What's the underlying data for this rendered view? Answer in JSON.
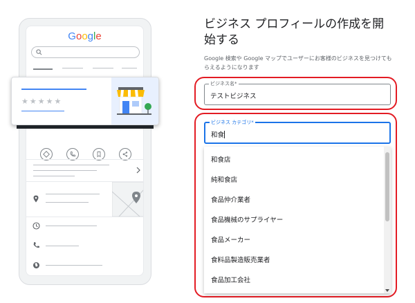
{
  "illustration": {
    "logo": [
      "G",
      "o",
      "o",
      "g",
      "l",
      "e"
    ],
    "stars": "★★★★★"
  },
  "form": {
    "title": "ビジネス プロフィールの作成を開始する",
    "subtitle": "Google 検索や Google マップでユーザーにお客様のビジネスを見つけてもらえるようになります",
    "business_name": {
      "label": "ビジネス名*",
      "value": "テストビジネス"
    },
    "business_category": {
      "label": "ビジネス カテゴリ*",
      "value": "和食"
    },
    "suggestions": [
      "和食店",
      "純和食店",
      "食品仲介業者",
      "食品機械のサプライヤー",
      "食品メーカー",
      "食料品製造販売業者",
      "食品加工会社"
    ]
  },
  "colors": {
    "highlight": "#e31b23",
    "focus_blue": "#1a73e8",
    "google_blue": "#4285f4"
  }
}
